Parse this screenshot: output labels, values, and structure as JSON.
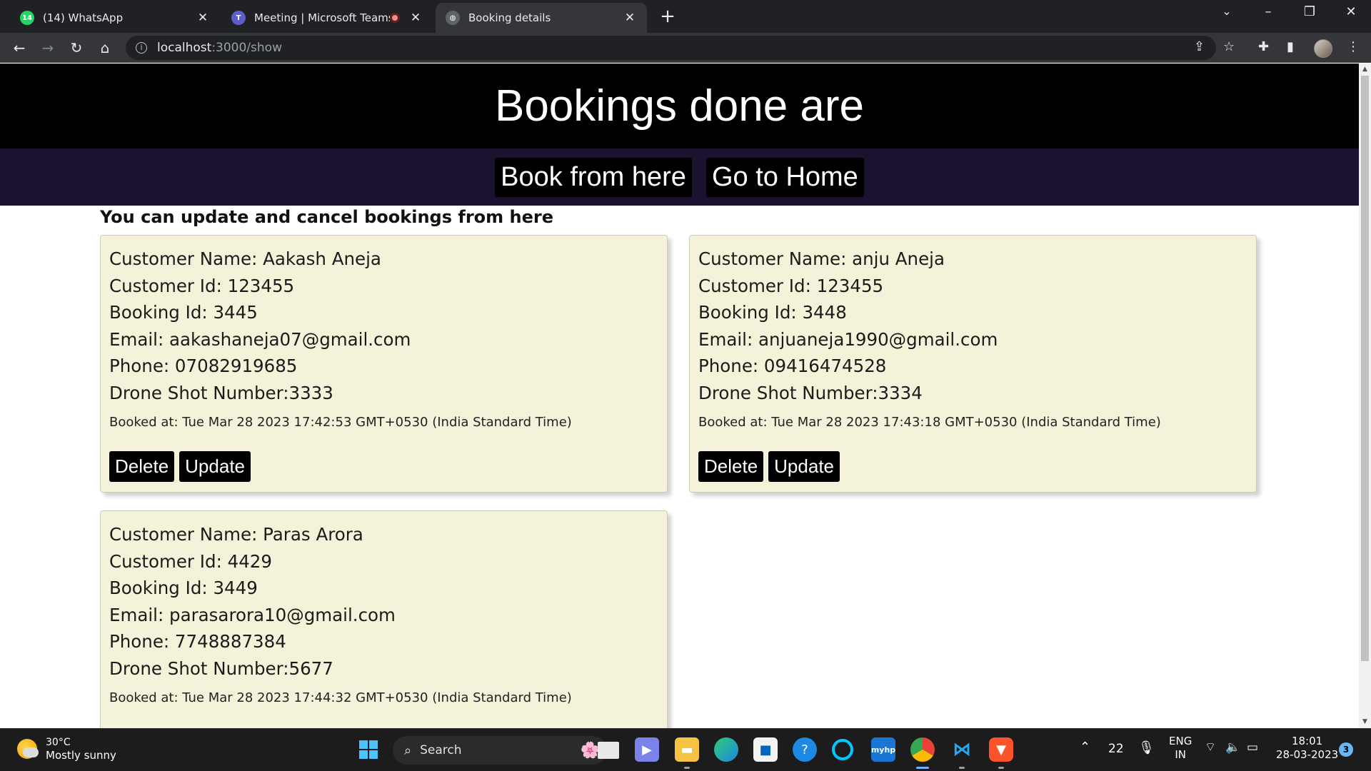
{
  "browser": {
    "tabs": [
      {
        "title": "(14) WhatsApp",
        "favicon": "whatsapp-icon",
        "color": "#25d366"
      },
      {
        "title": "Meeting | Microsoft Teams",
        "favicon": "teams-icon",
        "color": "#5b5fc7"
      },
      {
        "title": "Booking details",
        "favicon": "globe-icon",
        "color": "#5f6368"
      }
    ],
    "url_host": "localhost",
    "url_path": ":3000/show"
  },
  "page": {
    "header": "Bookings done are",
    "nav": {
      "book": "Book from here",
      "home": "Go to Home"
    },
    "subtitle": "You can update and cancel bookings from here",
    "buttons": {
      "delete": "Delete",
      "update": "Update"
    },
    "bookings": [
      {
        "name": "Customer Name: Aakash Aneja",
        "customer_id": "Customer Id: 123455",
        "booking_id": "Booking Id: 3445",
        "email": "Email: aakashaneja07@gmail.com",
        "phone": "Phone: 07082919685",
        "drone": "Drone Shot Number:3333",
        "booked_at": "Booked at: Tue Mar 28 2023 17:42:53 GMT+0530 (India Standard Time)"
      },
      {
        "name": "Customer Name: anju Aneja",
        "customer_id": "Customer Id: 123455",
        "booking_id": "Booking Id: 3448",
        "email": "Email: anjuaneja1990@gmail.com",
        "phone": "Phone: 09416474528",
        "drone": "Drone Shot Number:3334",
        "booked_at": "Booked at: Tue Mar 28 2023 17:43:18 GMT+0530 (India Standard Time)"
      },
      {
        "name": "Customer Name: Paras Arora",
        "customer_id": "Customer Id: 4429",
        "booking_id": "Booking Id: 3449",
        "email": "Email: parasarora10@gmail.com",
        "phone": "Phone: 7748887384",
        "drone": "Drone Shot Number:5677",
        "booked_at": "Booked at: Tue Mar 28 2023 17:44:32 GMT+0530 (India Standard Time)"
      }
    ]
  },
  "taskbar": {
    "weather_temp": "30°C",
    "weather_cond": "Mostly sunny",
    "search_label": "Search",
    "tray_count": "22",
    "lang_1": "ENG",
    "lang_2": "IN",
    "time": "18:01",
    "date": "28-03-2023",
    "notifications": "3"
  }
}
